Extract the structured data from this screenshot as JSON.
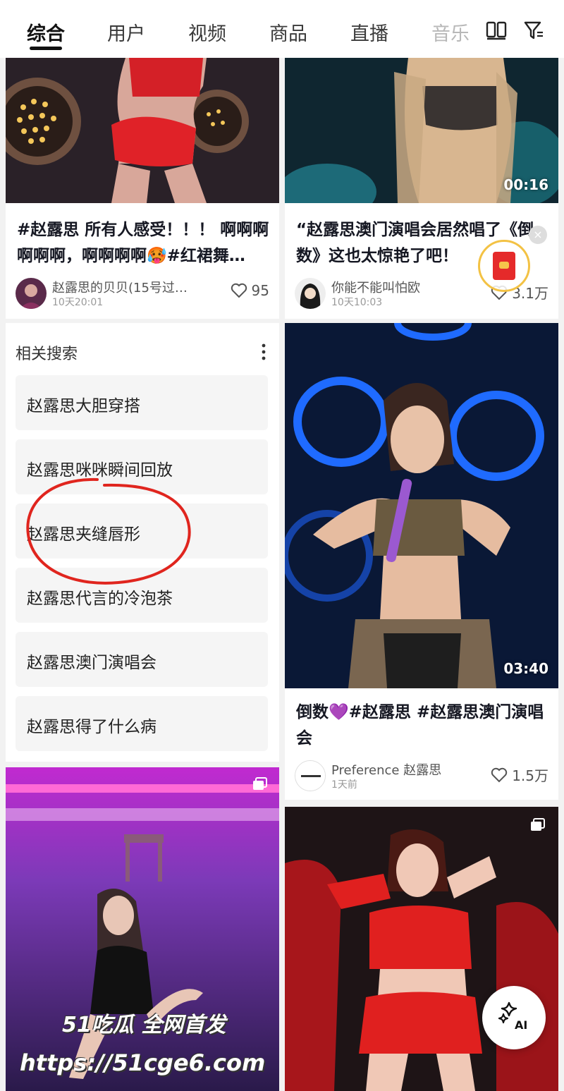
{
  "tabs": [
    {
      "label": "综合",
      "active": true
    },
    {
      "label": "用户"
    },
    {
      "label": "视频"
    },
    {
      "label": "商品"
    },
    {
      "label": "直播"
    },
    {
      "label": "音乐"
    }
  ],
  "cards": {
    "c1": {
      "title": "#赵露思 所有人感受！！！ 啊啊啊啊啊啊，啊啊啊啊🥵#红裙舞…",
      "author": "赵露思的贝贝(15号过…",
      "time": "10天20:01",
      "likes": "95"
    },
    "c2": {
      "duration": "00:16",
      "title": "“赵露思澳门演唱会居然唱了《倒数》这也太惊艳了吧！",
      "author": "你能不能叫怕欧",
      "time": "10天10:03",
      "likes": "3.1万"
    },
    "c3": {
      "duration": "03:40",
      "title": "倒数💜#赵露思 #赵露思澳门演唱会",
      "author": "Preference 赵露思",
      "time": "1天前",
      "likes": "1.5万"
    }
  },
  "related": {
    "heading": "相关搜索",
    "items": [
      "赵露思大胆穿搭",
      "赵露思咪咪瞬间回放",
      "赵露思夹缝唇形",
      "赵露思代言的冷泡茶",
      "赵露思澳门演唱会",
      "赵露思得了什么病"
    ]
  },
  "watermark": {
    "line1": "51吃瓜 全网首发",
    "line2": "https://51cge6.com"
  },
  "ai_label": "AI",
  "colors": {
    "accent_red": "#e0251e",
    "text": "#161823"
  }
}
